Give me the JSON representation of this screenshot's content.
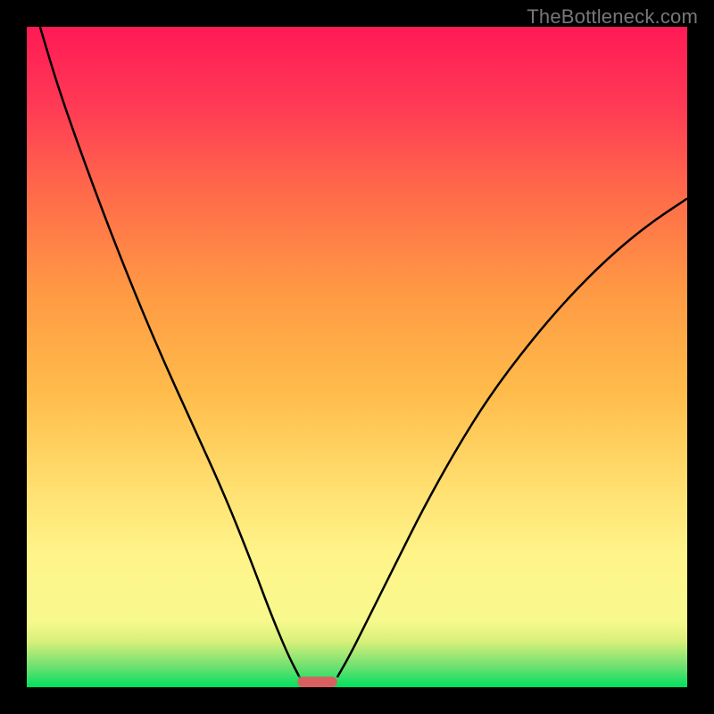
{
  "watermark": "TheBottleneck.com",
  "chart_data": {
    "type": "line",
    "title": "",
    "xlabel": "",
    "ylabel": "",
    "xlim": [
      0,
      100
    ],
    "ylim": [
      0,
      100
    ],
    "grid": false,
    "background_gradient_stops": [
      {
        "pos": 0,
        "color": "#00e060"
      },
      {
        "pos": 3,
        "color": "#6be070"
      },
      {
        "pos": 7,
        "color": "#d9f07a"
      },
      {
        "pos": 10,
        "color": "#f7f98d"
      },
      {
        "pos": 20,
        "color": "#fff48a"
      },
      {
        "pos": 30,
        "color": "#ffe070"
      },
      {
        "pos": 45,
        "color": "#ffbb4a"
      },
      {
        "pos": 60,
        "color": "#ff9944"
      },
      {
        "pos": 75,
        "color": "#ff6a4a"
      },
      {
        "pos": 88,
        "color": "#ff3a55"
      },
      {
        "pos": 100,
        "color": "#ff1a55"
      }
    ],
    "series": [
      {
        "name": "left-curve",
        "x": [
          2,
          5,
          10,
          15,
          20,
          25,
          30,
          34,
          37,
          39.5,
          41.3
        ],
        "y": [
          100,
          90,
          76,
          63,
          51,
          40,
          29,
          19,
          11,
          5,
          1.5
        ]
      },
      {
        "name": "right-curve",
        "x": [
          47,
          49,
          52,
          56,
          60,
          65,
          70,
          76,
          82,
          88,
          94,
          100
        ],
        "y": [
          1.5,
          5,
          11,
          19,
          27,
          36,
          44,
          52,
          59,
          65,
          70,
          74
        ]
      }
    ],
    "marker": {
      "name": "bottom-marker",
      "x_center": 44,
      "width": 6,
      "y": 0.8,
      "color": "#d86060"
    }
  }
}
